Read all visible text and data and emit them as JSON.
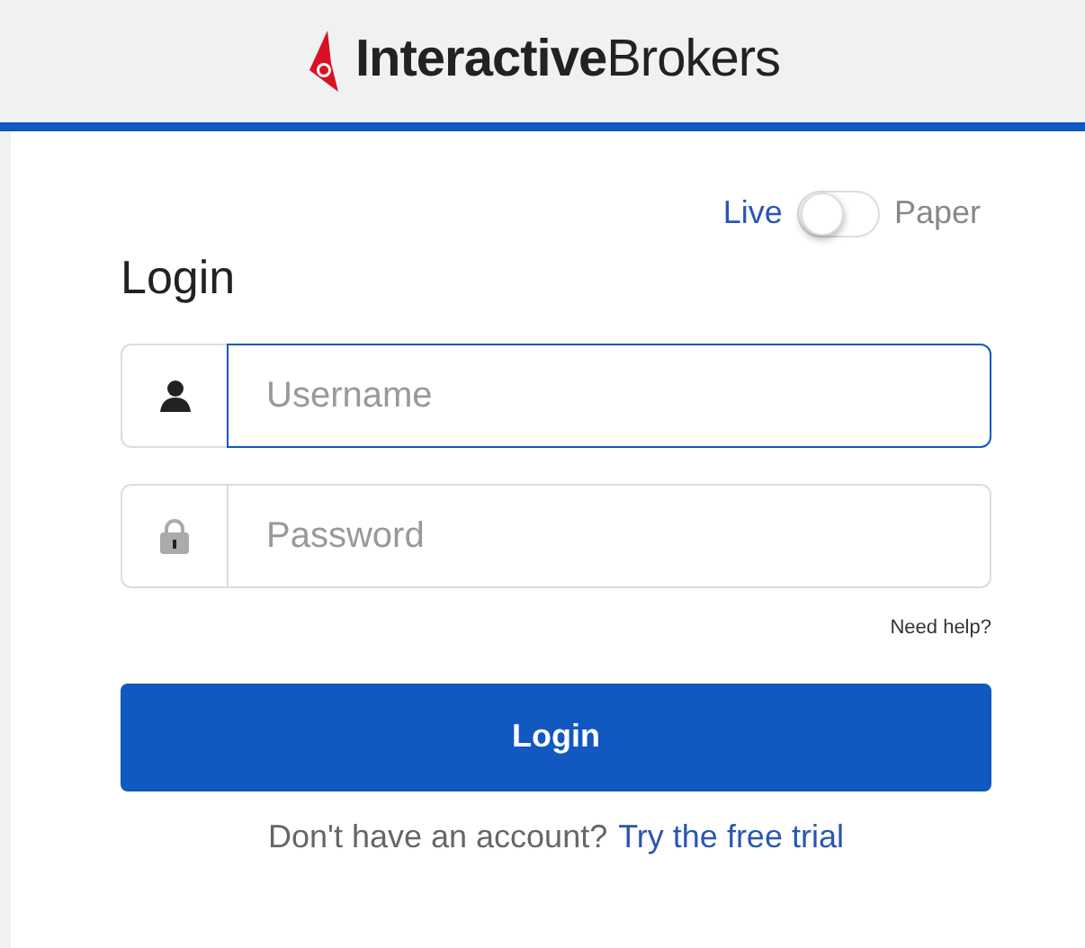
{
  "header": {
    "logo": "**Interactive**Brokers"
  },
  "mode_toggle": {
    "left_label": "Live",
    "right_label": "Paper",
    "on": false
  },
  "title": "Login",
  "fields": [
    {
      "kind": "user",
      "placeholder": "Username",
      "focused": true
    },
    {
      "kind": "lock",
      "placeholder": "Password",
      "focused": false
    }
  ],
  "help_link": "Need help?",
  "login_button": "Login",
  "signup": {
    "text": "Don't have an account?",
    "link": "Try the free trial"
  }
}
